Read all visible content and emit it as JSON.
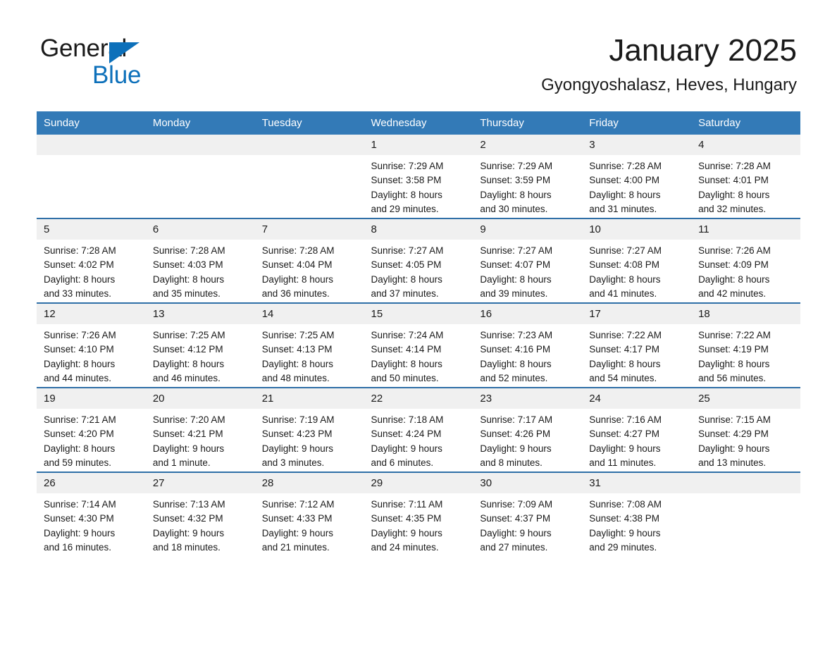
{
  "brand": {
    "name_part1": "General",
    "name_part2": "Blue",
    "accent_color": "#0d70ba"
  },
  "header": {
    "title": "January 2025",
    "subtitle": "Gyongyoshalasz, Heves, Hungary"
  },
  "calendar": {
    "header_color": "#337ab7",
    "daynum_band_color": "#f0f0f0",
    "row_divider_color": "#2f6fa7",
    "weekday_headers": [
      "Sunday",
      "Monday",
      "Tuesday",
      "Wednesday",
      "Thursday",
      "Friday",
      "Saturday"
    ],
    "weeks": [
      [
        {
          "day": "",
          "lines": []
        },
        {
          "day": "",
          "lines": []
        },
        {
          "day": "",
          "lines": []
        },
        {
          "day": "1",
          "lines": [
            "Sunrise: 7:29 AM",
            "Sunset: 3:58 PM",
            "Daylight: 8 hours",
            "and 29 minutes."
          ]
        },
        {
          "day": "2",
          "lines": [
            "Sunrise: 7:29 AM",
            "Sunset: 3:59 PM",
            "Daylight: 8 hours",
            "and 30 minutes."
          ]
        },
        {
          "day": "3",
          "lines": [
            "Sunrise: 7:28 AM",
            "Sunset: 4:00 PM",
            "Daylight: 8 hours",
            "and 31 minutes."
          ]
        },
        {
          "day": "4",
          "lines": [
            "Sunrise: 7:28 AM",
            "Sunset: 4:01 PM",
            "Daylight: 8 hours",
            "and 32 minutes."
          ]
        }
      ],
      [
        {
          "day": "5",
          "lines": [
            "Sunrise: 7:28 AM",
            "Sunset: 4:02 PM",
            "Daylight: 8 hours",
            "and 33 minutes."
          ]
        },
        {
          "day": "6",
          "lines": [
            "Sunrise: 7:28 AM",
            "Sunset: 4:03 PM",
            "Daylight: 8 hours",
            "and 35 minutes."
          ]
        },
        {
          "day": "7",
          "lines": [
            "Sunrise: 7:28 AM",
            "Sunset: 4:04 PM",
            "Daylight: 8 hours",
            "and 36 minutes."
          ]
        },
        {
          "day": "8",
          "lines": [
            "Sunrise: 7:27 AM",
            "Sunset: 4:05 PM",
            "Daylight: 8 hours",
            "and 37 minutes."
          ]
        },
        {
          "day": "9",
          "lines": [
            "Sunrise: 7:27 AM",
            "Sunset: 4:07 PM",
            "Daylight: 8 hours",
            "and 39 minutes."
          ]
        },
        {
          "day": "10",
          "lines": [
            "Sunrise: 7:27 AM",
            "Sunset: 4:08 PM",
            "Daylight: 8 hours",
            "and 41 minutes."
          ]
        },
        {
          "day": "11",
          "lines": [
            "Sunrise: 7:26 AM",
            "Sunset: 4:09 PM",
            "Daylight: 8 hours",
            "and 42 minutes."
          ]
        }
      ],
      [
        {
          "day": "12",
          "lines": [
            "Sunrise: 7:26 AM",
            "Sunset: 4:10 PM",
            "Daylight: 8 hours",
            "and 44 minutes."
          ]
        },
        {
          "day": "13",
          "lines": [
            "Sunrise: 7:25 AM",
            "Sunset: 4:12 PM",
            "Daylight: 8 hours",
            "and 46 minutes."
          ]
        },
        {
          "day": "14",
          "lines": [
            "Sunrise: 7:25 AM",
            "Sunset: 4:13 PM",
            "Daylight: 8 hours",
            "and 48 minutes."
          ]
        },
        {
          "day": "15",
          "lines": [
            "Sunrise: 7:24 AM",
            "Sunset: 4:14 PM",
            "Daylight: 8 hours",
            "and 50 minutes."
          ]
        },
        {
          "day": "16",
          "lines": [
            "Sunrise: 7:23 AM",
            "Sunset: 4:16 PM",
            "Daylight: 8 hours",
            "and 52 minutes."
          ]
        },
        {
          "day": "17",
          "lines": [
            "Sunrise: 7:22 AM",
            "Sunset: 4:17 PM",
            "Daylight: 8 hours",
            "and 54 minutes."
          ]
        },
        {
          "day": "18",
          "lines": [
            "Sunrise: 7:22 AM",
            "Sunset: 4:19 PM",
            "Daylight: 8 hours",
            "and 56 minutes."
          ]
        }
      ],
      [
        {
          "day": "19",
          "lines": [
            "Sunrise: 7:21 AM",
            "Sunset: 4:20 PM",
            "Daylight: 8 hours",
            "and 59 minutes."
          ]
        },
        {
          "day": "20",
          "lines": [
            "Sunrise: 7:20 AM",
            "Sunset: 4:21 PM",
            "Daylight: 9 hours",
            "and 1 minute."
          ]
        },
        {
          "day": "21",
          "lines": [
            "Sunrise: 7:19 AM",
            "Sunset: 4:23 PM",
            "Daylight: 9 hours",
            "and 3 minutes."
          ]
        },
        {
          "day": "22",
          "lines": [
            "Sunrise: 7:18 AM",
            "Sunset: 4:24 PM",
            "Daylight: 9 hours",
            "and 6 minutes."
          ]
        },
        {
          "day": "23",
          "lines": [
            "Sunrise: 7:17 AM",
            "Sunset: 4:26 PM",
            "Daylight: 9 hours",
            "and 8 minutes."
          ]
        },
        {
          "day": "24",
          "lines": [
            "Sunrise: 7:16 AM",
            "Sunset: 4:27 PM",
            "Daylight: 9 hours",
            "and 11 minutes."
          ]
        },
        {
          "day": "25",
          "lines": [
            "Sunrise: 7:15 AM",
            "Sunset: 4:29 PM",
            "Daylight: 9 hours",
            "and 13 minutes."
          ]
        }
      ],
      [
        {
          "day": "26",
          "lines": [
            "Sunrise: 7:14 AM",
            "Sunset: 4:30 PM",
            "Daylight: 9 hours",
            "and 16 minutes."
          ]
        },
        {
          "day": "27",
          "lines": [
            "Sunrise: 7:13 AM",
            "Sunset: 4:32 PM",
            "Daylight: 9 hours",
            "and 18 minutes."
          ]
        },
        {
          "day": "28",
          "lines": [
            "Sunrise: 7:12 AM",
            "Sunset: 4:33 PM",
            "Daylight: 9 hours",
            "and 21 minutes."
          ]
        },
        {
          "day": "29",
          "lines": [
            "Sunrise: 7:11 AM",
            "Sunset: 4:35 PM",
            "Daylight: 9 hours",
            "and 24 minutes."
          ]
        },
        {
          "day": "30",
          "lines": [
            "Sunrise: 7:09 AM",
            "Sunset: 4:37 PM",
            "Daylight: 9 hours",
            "and 27 minutes."
          ]
        },
        {
          "day": "31",
          "lines": [
            "Sunrise: 7:08 AM",
            "Sunset: 4:38 PM",
            "Daylight: 9 hours",
            "and 29 minutes."
          ]
        },
        {
          "day": "",
          "lines": []
        }
      ]
    ]
  }
}
